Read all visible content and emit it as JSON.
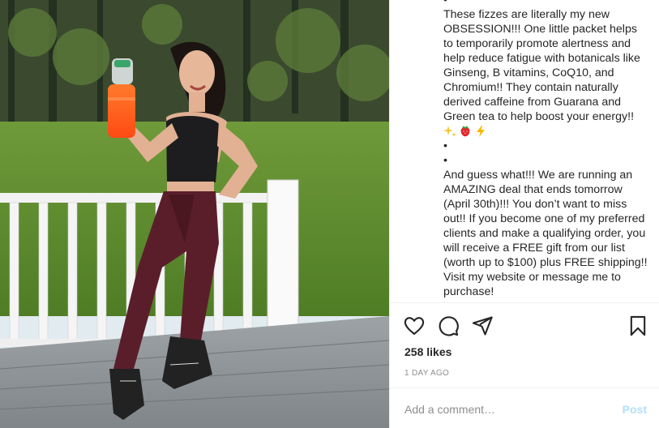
{
  "caption": {
    "top_bullet": "•",
    "paragraph1": "These fizzes are literally my new OBSESSION!!! One little packet helps to temporarily promote alertness and help reduce fatigue with botanicals like Ginseng, B vitamins, CoQ10, and Chromium!! They contain naturally derived caffeine from Guarana and Green tea to help boost your energy!!",
    "emojis": [
      "sparkles",
      "strawberry",
      "high-voltage"
    ],
    "bullet1": "•",
    "bullet2": "•",
    "paragraph2": "And guess what!!! We are running an AMAZING deal that ends tomorrow (April 30th)!!! You don’t want to miss out!! If you become one of my preferred clients and make a qualifying order, you will receive a FREE gift from our list (worth up to $100) plus FREE shipping!! Visit my website or message me to purchase!"
  },
  "actions": {
    "icons": [
      "heart-icon",
      "comment-icon",
      "share-icon",
      "bookmark-icon"
    ]
  },
  "likes": "258 likes",
  "timestamp": "1 DAY AGO",
  "comment": {
    "placeholder": "Add a comment…",
    "post_label": "Post"
  },
  "colors": {
    "text": "#262626",
    "muted": "#8e8e8e",
    "post_disabled": "#b2dffc",
    "divider": "#efefef"
  }
}
